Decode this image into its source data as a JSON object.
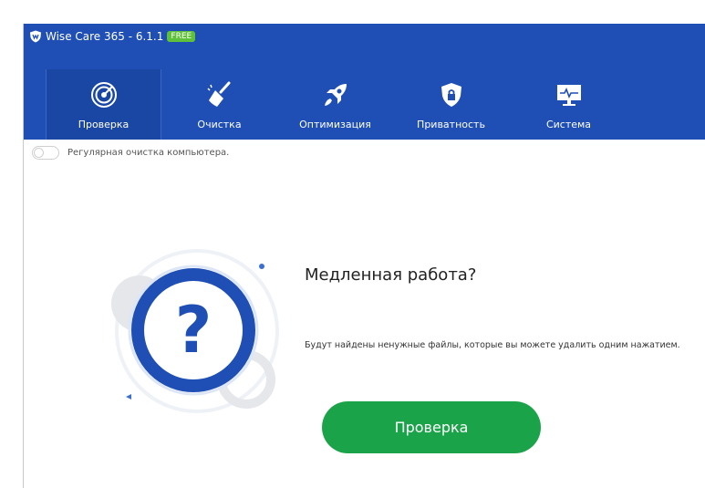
{
  "app": {
    "title": "Wise Care 365 - 6.1.1",
    "badge": "FREE",
    "logo_icon": "shield-logo-icon",
    "colors": {
      "header": "#1f4fb5",
      "accent": "#1ba349",
      "badge": "#5fc13a"
    }
  },
  "nav": {
    "tabs": [
      {
        "label": "Проверка",
        "icon": "radar-icon",
        "active": true
      },
      {
        "label": "Очистка",
        "icon": "broom-icon",
        "active": false
      },
      {
        "label": "Оптимизация",
        "icon": "rocket-icon",
        "active": false
      },
      {
        "label": "Приватность",
        "icon": "privacy-shield-icon",
        "active": false
      },
      {
        "label": "Система",
        "icon": "monitor-icon",
        "active": false
      }
    ]
  },
  "schedule": {
    "label": "Регулярная очистка компьютера.",
    "enabled": false
  },
  "main": {
    "heading": "Медленная работа?",
    "description": "Будут найдены ненужные файлы, которые вы можете удалить одним нажатием.",
    "button_label": "Проверка",
    "illustration_icon": "question-mark-icon"
  }
}
